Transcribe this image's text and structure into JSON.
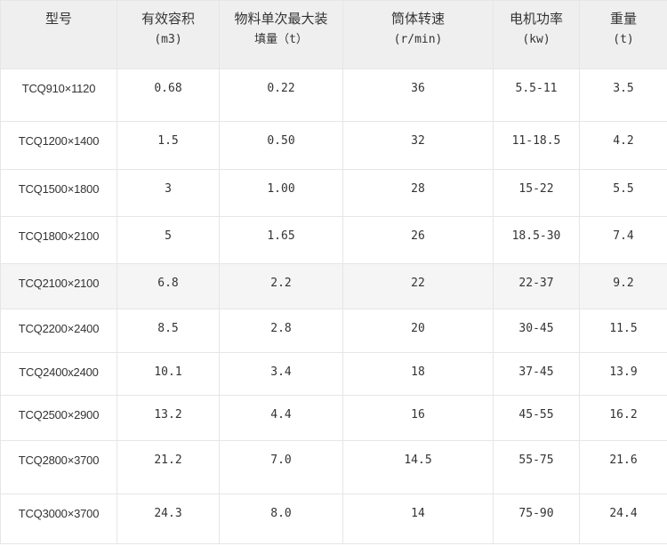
{
  "headers": [
    {
      "line1": "型号",
      "line2": ""
    },
    {
      "line1": "有效容积",
      "line2": "(m3)"
    },
    {
      "line1": "物料单次最大装",
      "line2": "填量（t）"
    },
    {
      "line1": "筒体转速",
      "line2": "(r/min)"
    },
    {
      "line1": "电机功率",
      "line2": "(kw)"
    },
    {
      "line1": "重量",
      "line2": "(t)"
    }
  ],
  "rows": [
    {
      "model": "TCQ910×1120",
      "volume": "0.68",
      "load": "0.22",
      "speed": "36",
      "power": "5.5-11",
      "weight": "3.5"
    },
    {
      "model": "TCQ1200×1400",
      "volume": "1.5",
      "load": "0.50",
      "speed": "32",
      "power": "11-18.5",
      "weight": "4.2"
    },
    {
      "model": "TCQ1500×1800",
      "volume": "3",
      "load": "1.00",
      "speed": "28",
      "power": "15-22",
      "weight": "5.5"
    },
    {
      "model": "TCQ1800×2100",
      "volume": "5",
      "load": "1.65",
      "speed": "26",
      "power": "18.5-30",
      "weight": "7.4"
    },
    {
      "model": "TCQ2100×2100",
      "volume": "6.8",
      "load": "2.2",
      "speed": "22",
      "power": "22-37",
      "weight": "9.2"
    },
    {
      "model": "TCQ2200×2400",
      "volume": "8.5",
      "load": "2.8",
      "speed": "20",
      "power": "30-45",
      "weight": "11.5"
    },
    {
      "model": "TCQ2400x2400",
      "volume": "10.1",
      "load": "3.4",
      "speed": "18",
      "power": "37-45",
      "weight": "13.9"
    },
    {
      "model": "TCQ2500×2900",
      "volume": "13.2",
      "load": "4.4",
      "speed": "16",
      "power": "45-55",
      "weight": "16.2"
    },
    {
      "model": "TCQ2800×3700",
      "volume": "21.2",
      "load": "7.0",
      "speed": "14.5",
      "power": "55-75",
      "weight": "21.6"
    },
    {
      "model": "TCQ3000×3700",
      "volume": "24.3",
      "load": "8.0",
      "speed": "14",
      "power": "75-90",
      "weight": "24.4"
    }
  ],
  "colors": {
    "header_bg": "#efefef",
    "alt_row_bg": "#f5f5f5",
    "border": "#e6e6e6",
    "text": "#333333"
  }
}
